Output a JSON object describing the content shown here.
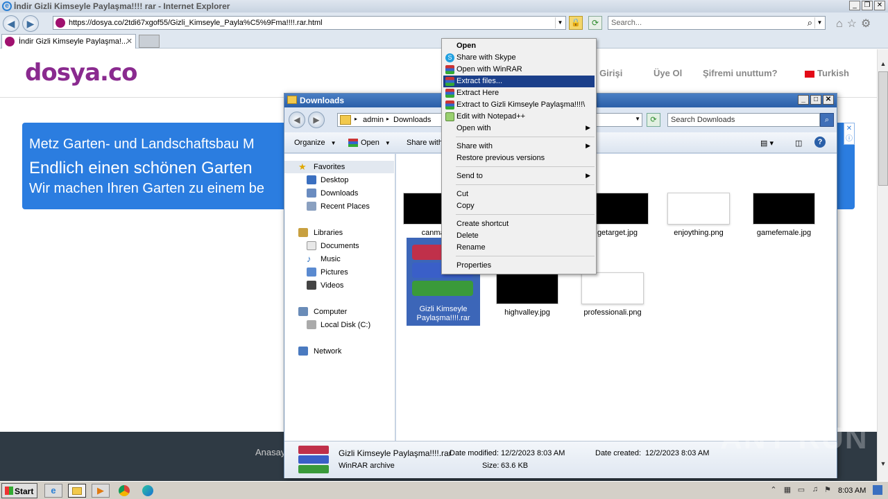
{
  "browser": {
    "title": "İndir Gizli Kimseyle Paylaşma!!!! rar - Internet Explorer",
    "url": "https://dosya.co/2tdi67xgof55/Gizli_Kimseyle_Payla%C5%9Fma!!!!.rar.html",
    "search_placeholder": "Search...",
    "tab_label": "İndir Gizli Kimseyle Paylaşma!..."
  },
  "site": {
    "logo": "dosya.co",
    "nav": [
      "ıcı Girişi",
      "Üye Ol",
      "Şifremi unuttum?",
      "Turkish"
    ],
    "ad": {
      "line1": "Metz Garten- und Landschaftsbau M",
      "line2": "Endlich einen schönen Garten",
      "line3": "Wir machen Ihren Garten zu einem be"
    },
    "footer_link": "Anasay"
  },
  "explorer": {
    "title": "Downloads",
    "breadcrumb": [
      "admin",
      "Downloads"
    ],
    "search_placeholder": "Search Downloads",
    "toolbar": {
      "organize": "Organize",
      "open": "Open",
      "share": "Share with"
    },
    "nav_pane": {
      "favorites": "Favorites",
      "favorites_items": [
        "Desktop",
        "Downloads",
        "Recent Places"
      ],
      "libraries": "Libraries",
      "libraries_items": [
        "Documents",
        "Music",
        "Pictures",
        "Videos"
      ],
      "computer": "Computer",
      "computer_items": [
        "Local Disk (C:)"
      ],
      "network": "Network"
    },
    "files": [
      {
        "name": "canmar",
        "thumb": "dark"
      },
      {
        "name": "getarget.jpg",
        "thumb": "dark"
      },
      {
        "name": "enjoything.png",
        "thumb": "light"
      },
      {
        "name": "gamefemale.jpg",
        "thumb": "dark"
      },
      {
        "name": "highvalley.jpg",
        "thumb": "dark"
      },
      {
        "name": "professionali.png",
        "thumb": "light"
      }
    ],
    "selected_file": "Gizli Kimseyle Paylaşma!!!!.rar",
    "details": {
      "filename": "Gizli Kimseyle Paylaşma!!!!.rar",
      "type": "WinRAR archive",
      "modified_label": "Date modified:",
      "modified_value": "12/2/2023 8:03 AM",
      "size_label": "Size:",
      "size_value": "63.6 KB",
      "created_label": "Date created:",
      "created_value": "12/2/2023 8:03 AM"
    }
  },
  "context_menu": {
    "items": [
      {
        "label": "Open",
        "bold": true
      },
      {
        "label": "Share with Skype",
        "icon": "skype-icon"
      },
      {
        "label": "Open with WinRAR",
        "icon": "winrar-icon"
      },
      {
        "label": "Extract files...",
        "icon": "winrar-icon",
        "highlighted": true
      },
      {
        "label": "Extract Here",
        "icon": "winrar-icon"
      },
      {
        "label": "Extract to Gizli Kimseyle Paylaşma!!!!\\",
        "icon": "winrar-icon"
      },
      {
        "label": "Edit with Notepad++",
        "icon": "notepad-icon"
      },
      {
        "label": "Open with",
        "submenu": true
      },
      {
        "label": "Share with",
        "submenu": true
      },
      {
        "label": "Restore previous versions"
      },
      {
        "label": "Send to",
        "submenu": true
      },
      {
        "label": "Cut"
      },
      {
        "label": "Copy"
      },
      {
        "label": "Create shortcut"
      },
      {
        "label": "Delete"
      },
      {
        "label": "Rename"
      },
      {
        "label": "Properties"
      }
    ]
  },
  "taskbar": {
    "start": "Start",
    "clock": "8:03 AM"
  },
  "watermark": "ANY RUN",
  "colors": {
    "accent": "#1b3f8a",
    "ad_bg": "#2b7de0",
    "logo": "#8a2a8f",
    "selection": "#3c66b8"
  }
}
